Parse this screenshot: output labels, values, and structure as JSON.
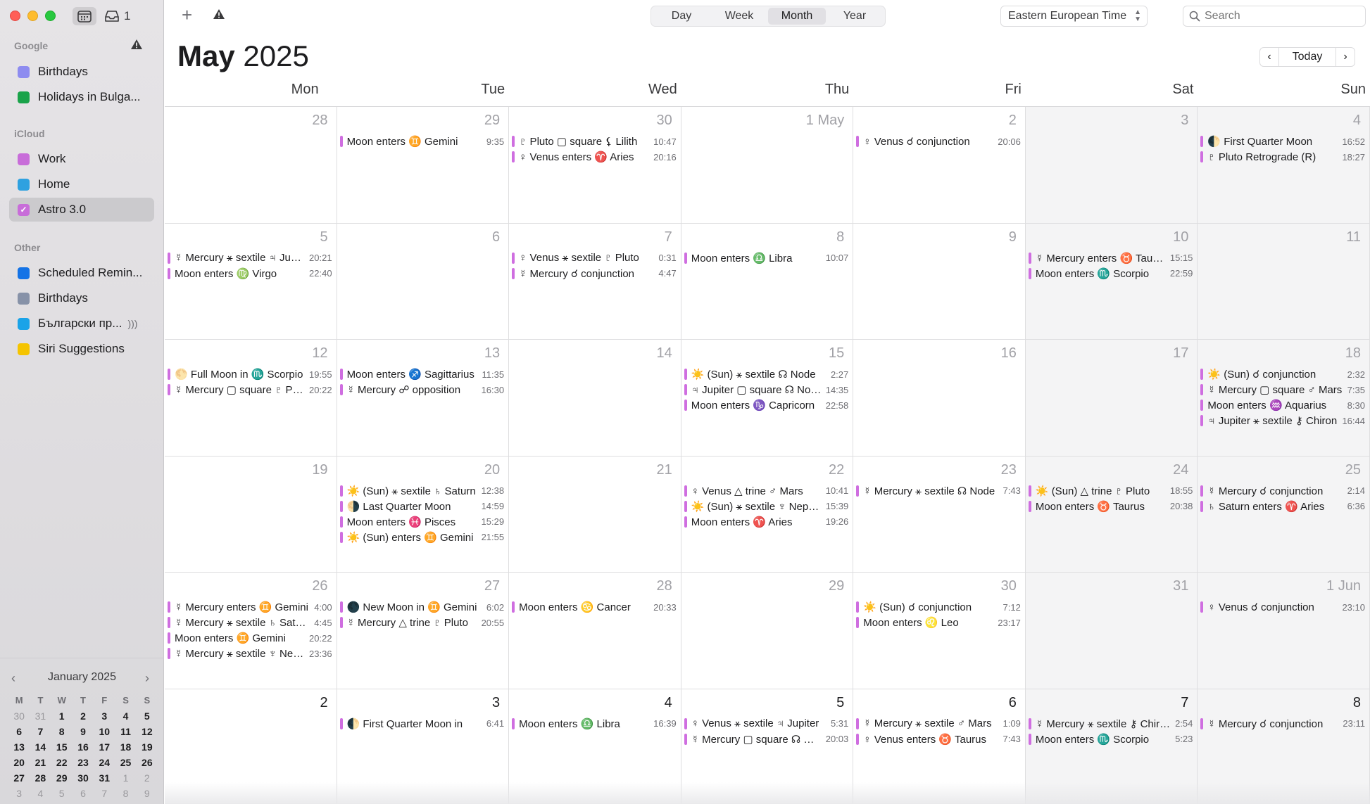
{
  "window": {
    "inbox_count": "1"
  },
  "sidebar": {
    "sections": [
      {
        "label": "Google",
        "items": [
          {
            "label": "Birthdays",
            "color": "#8e8cf0",
            "checked": false
          },
          {
            "label": "Holidays in Bulga...",
            "color": "#1aa34a",
            "checked": false
          }
        ]
      },
      {
        "label": "iCloud",
        "items": [
          {
            "label": "Work",
            "color": "#c86dd9",
            "checked": false
          },
          {
            "label": "Home",
            "color": "#2ea1e0",
            "checked": false
          },
          {
            "label": "Astro 3.0",
            "color": "#c86dd9",
            "checked": true
          }
        ]
      },
      {
        "label": "Other",
        "items": [
          {
            "label": "Scheduled Remin...",
            "color": "#1473e6",
            "checked": false
          },
          {
            "label": "Birthdays",
            "color": "#8792a8",
            "checked": false
          },
          {
            "label": "Български пр...",
            "color": "#1aa3e8",
            "checked": false
          },
          {
            "label": "Siri Suggestions",
            "color": "#f5c400",
            "checked": false
          }
        ]
      }
    ]
  },
  "mini_calendar": {
    "title": "January 2025",
    "weekdays": [
      "M",
      "T",
      "W",
      "T",
      "F",
      "S",
      "S"
    ],
    "weeks": [
      [
        {
          "d": "30",
          "dim": true
        },
        {
          "d": "31",
          "dim": true
        },
        {
          "d": "1"
        },
        {
          "d": "2"
        },
        {
          "d": "3"
        },
        {
          "d": "4"
        },
        {
          "d": "5"
        }
      ],
      [
        {
          "d": "6"
        },
        {
          "d": "7"
        },
        {
          "d": "8"
        },
        {
          "d": "9"
        },
        {
          "d": "10"
        },
        {
          "d": "11"
        },
        {
          "d": "12"
        }
      ],
      [
        {
          "d": "13"
        },
        {
          "d": "14"
        },
        {
          "d": "15"
        },
        {
          "d": "16"
        },
        {
          "d": "17"
        },
        {
          "d": "18"
        },
        {
          "d": "19"
        }
      ],
      [
        {
          "d": "20"
        },
        {
          "d": "21"
        },
        {
          "d": "22"
        },
        {
          "d": "23"
        },
        {
          "d": "24"
        },
        {
          "d": "25"
        },
        {
          "d": "26"
        }
      ],
      [
        {
          "d": "27"
        },
        {
          "d": "28"
        },
        {
          "d": "29"
        },
        {
          "d": "30"
        },
        {
          "d": "31"
        },
        {
          "d": "1",
          "dim": true
        },
        {
          "d": "2",
          "dim": true
        }
      ],
      [
        {
          "d": "3",
          "dim": true
        },
        {
          "d": "4",
          "dim": true
        },
        {
          "d": "5",
          "dim": true
        },
        {
          "d": "6",
          "dim": true
        },
        {
          "d": "7",
          "dim": true
        },
        {
          "d": "8",
          "dim": true
        },
        {
          "d": "9",
          "dim": true
        }
      ]
    ]
  },
  "toolbar": {
    "views": [
      "Day",
      "Week",
      "Month",
      "Year"
    ],
    "active_view": "Month",
    "timezone": "Eastern European Time",
    "search_placeholder": "Search"
  },
  "header": {
    "month": "May",
    "year": "2025",
    "today_label": "Today"
  },
  "weekdays": [
    "Mon",
    "Tue",
    "Wed",
    "Thu",
    "Fri",
    "Sat",
    "Sun"
  ],
  "event_color": "#cf6ee0",
  "weeks": [
    [
      {
        "day": "28",
        "events": []
      },
      {
        "day": "29",
        "events": [
          {
            "t": "Moon enters ♊️ Gemini",
            "tm": "9:35"
          }
        ]
      },
      {
        "day": "30",
        "events": [
          {
            "t": "♇ Pluto ▢ square ⚸ Lilith",
            "tm": "10:47"
          },
          {
            "t": "♀ Venus enters ♈️ Aries",
            "tm": "20:16"
          }
        ]
      },
      {
        "day": "1 May",
        "events": []
      },
      {
        "day": "2",
        "events": [
          {
            "t": "♀ Venus ☌ conjunction",
            "tm": "20:06"
          }
        ]
      },
      {
        "day": "3",
        "events": []
      },
      {
        "day": "4",
        "events": [
          {
            "t": "🌓 First Quarter Moon",
            "tm": "16:52"
          },
          {
            "t": "♇ Pluto Retrograde (R)",
            "tm": "18:27"
          }
        ]
      }
    ],
    [
      {
        "day": "5",
        "events": [
          {
            "t": "☿ Mercury ⚹ sextile ♃ Jupiter",
            "tm": "20:21"
          },
          {
            "t": "Moon enters ♍️ Virgo",
            "tm": "22:40"
          }
        ]
      },
      {
        "day": "6",
        "events": []
      },
      {
        "day": "7",
        "events": [
          {
            "t": "♀ Venus ⚹ sextile ♇ Pluto",
            "tm": "0:31"
          },
          {
            "t": "☿ Mercury ☌ conjunction",
            "tm": "4:47"
          }
        ]
      },
      {
        "day": "8",
        "events": [
          {
            "t": "Moon enters ♎️ Libra",
            "tm": "10:07"
          }
        ]
      },
      {
        "day": "9",
        "events": []
      },
      {
        "day": "10",
        "events": [
          {
            "t": "☿ Mercury enters ♉️ Taurus",
            "tm": "15:15"
          },
          {
            "t": "Moon enters ♏️ Scorpio",
            "tm": "22:59"
          }
        ]
      },
      {
        "day": "11",
        "events": []
      }
    ],
    [
      {
        "day": "12",
        "events": [
          {
            "t": "🌕 Full Moon in ♏️ Scorpio",
            "tm": "19:55"
          },
          {
            "t": "☿ Mercury ▢ square ♇ Pluto",
            "tm": "20:22"
          }
        ]
      },
      {
        "day": "13",
        "events": [
          {
            "t": "Moon enters ♐️ Sagittarius",
            "tm": "11:35"
          },
          {
            "t": "☿ Mercury ☍ opposition",
            "tm": "16:30"
          }
        ]
      },
      {
        "day": "14",
        "events": []
      },
      {
        "day": "15",
        "events": [
          {
            "t": "☀️ (Sun) ⚹ sextile ☊ Node",
            "tm": "2:27"
          },
          {
            "t": "♃ Jupiter ▢ square ☊ Node",
            "tm": "14:35"
          },
          {
            "t": "Moon enters ♑️ Capricorn",
            "tm": "22:58"
          }
        ]
      },
      {
        "day": "16",
        "events": []
      },
      {
        "day": "17",
        "events": []
      },
      {
        "day": "18",
        "events": [
          {
            "t": "☀️ (Sun) ☌ conjunction",
            "tm": "2:32"
          },
          {
            "t": "☿ Mercury ▢ square ♂ Mars",
            "tm": "7:35"
          },
          {
            "t": "Moon enters ♒️ Aquarius",
            "tm": "8:30"
          },
          {
            "t": "♃ Jupiter ⚹ sextile ⚷ Chiron",
            "tm": "16:44"
          }
        ]
      }
    ],
    [
      {
        "day": "19",
        "events": []
      },
      {
        "day": "20",
        "events": [
          {
            "t": "☀️ (Sun) ⚹ sextile ♄ Saturn",
            "tm": "12:38"
          },
          {
            "t": "🌗 Last Quarter Moon",
            "tm": "14:59"
          },
          {
            "t": "Moon enters ♓️ Pisces",
            "tm": "15:29"
          },
          {
            "t": "☀️ (Sun) enters ♊️ Gemini",
            "tm": "21:55"
          }
        ]
      },
      {
        "day": "21",
        "events": []
      },
      {
        "day": "22",
        "events": [
          {
            "t": "♀ Venus △ trine ♂ Mars",
            "tm": "10:41"
          },
          {
            "t": "☀️ (Sun) ⚹ sextile ♆ Neptune",
            "tm": "15:39"
          },
          {
            "t": "Moon enters ♈️ Aries",
            "tm": "19:26"
          }
        ]
      },
      {
        "day": "23",
        "events": [
          {
            "t": "☿ Mercury ⚹ sextile ☊ Node",
            "tm": "7:43"
          }
        ]
      },
      {
        "day": "24",
        "events": [
          {
            "t": "☀️ (Sun) △ trine ♇ Pluto",
            "tm": "18:55"
          },
          {
            "t": "Moon enters ♉️ Taurus",
            "tm": "20:38"
          }
        ]
      },
      {
        "day": "25",
        "events": [
          {
            "t": "☿ Mercury ☌ conjunction",
            "tm": "2:14"
          },
          {
            "t": "♄ Saturn enters ♈️ Aries",
            "tm": "6:36"
          }
        ]
      }
    ],
    [
      {
        "day": "26",
        "events": [
          {
            "t": "☿ Mercury enters ♊️ Gemini",
            "tm": "4:00"
          },
          {
            "t": "☿ Mercury ⚹ sextile ♄ Saturn",
            "tm": "4:45"
          },
          {
            "t": "Moon enters ♊️ Gemini",
            "tm": "20:22"
          },
          {
            "t": "☿ Mercury ⚹ sextile ♆ Neptune",
            "tm": "23:36"
          }
        ]
      },
      {
        "day": "27",
        "events": [
          {
            "t": "🌑 New Moon in ♊️ Gemini",
            "tm": "6:02"
          },
          {
            "t": "☿ Mercury △ trine ♇ Pluto",
            "tm": "20:55"
          }
        ]
      },
      {
        "day": "28",
        "events": [
          {
            "t": "Moon enters ♋️ Cancer",
            "tm": "20:33"
          }
        ]
      },
      {
        "day": "29",
        "events": []
      },
      {
        "day": "30",
        "events": [
          {
            "t": "☀️ (Sun) ☌ conjunction",
            "tm": "7:12"
          },
          {
            "t": "Moon enters ♌️ Leo",
            "tm": "23:17"
          }
        ]
      },
      {
        "day": "31",
        "events": []
      },
      {
        "day": "1 Jun",
        "events": [
          {
            "t": "♀ Venus ☌ conjunction",
            "tm": "23:10"
          }
        ]
      }
    ],
    [
      {
        "day": "2",
        "dark": true,
        "events": []
      },
      {
        "day": "3",
        "dark": true,
        "events": [
          {
            "t": "🌓 First Quarter Moon in",
            "tm": "6:41"
          }
        ]
      },
      {
        "day": "4",
        "dark": true,
        "events": [
          {
            "t": "Moon enters ♎️ Libra",
            "tm": "16:39"
          }
        ]
      },
      {
        "day": "5",
        "dark": true,
        "events": [
          {
            "t": "♀ Venus ⚹ sextile ♃ Jupiter",
            "tm": "5:31"
          },
          {
            "t": "☿ Mercury ▢ square ☊ Node",
            "tm": "20:03"
          }
        ]
      },
      {
        "day": "6",
        "dark": true,
        "events": [
          {
            "t": "☿ Mercury ⚹ sextile ♂ Mars",
            "tm": "1:09"
          },
          {
            "t": "♀ Venus enters ♉️ Taurus",
            "tm": "7:43"
          }
        ]
      },
      {
        "day": "7",
        "dark": true,
        "events": [
          {
            "t": "☿ Mercury ⚹ sextile ⚷ Chiron",
            "tm": "2:54"
          },
          {
            "t": "Moon enters ♏️ Scorpio",
            "tm": "5:23"
          }
        ]
      },
      {
        "day": "8",
        "dark": true,
        "events": [
          {
            "t": "☿ Mercury ☌ conjunction",
            "tm": "23:11"
          }
        ]
      }
    ]
  ]
}
